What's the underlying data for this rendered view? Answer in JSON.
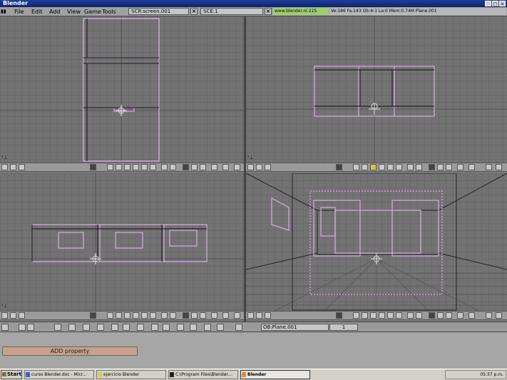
{
  "window": {
    "title": "Blender",
    "min": "_",
    "max": "□",
    "close": "×"
  },
  "menu": [
    "File",
    "Edit",
    "Add",
    "View",
    "Game",
    "Tools"
  ],
  "screen_field": "SCR:screen.001",
  "scene_field": "SCE:1",
  "url": "www.blender.nl 225",
  "stats": "Ve:186 Fa:143  Ob:4-1 La:0  Mem:0.74M  Plane.001",
  "viewport_corner": "⁺ᵧ",
  "buttons_window": {
    "object_field": "OB:Plane.001",
    "object_number": "1",
    "add_property": "ADD property"
  },
  "taskbar": {
    "start": "Start",
    "tasks": [
      {
        "label": "curso Blender.doc - Micr...",
        "icon": "word-icon"
      },
      {
        "label": "ejercicio Blender",
        "icon": "folder-icon"
      },
      {
        "label": "C:\\Program Files\\Blender...",
        "icon": "console-icon"
      },
      {
        "label": "Blender",
        "icon": "blender-icon",
        "active": true
      }
    ],
    "clock": "05:37 p.m."
  },
  "colors": {
    "wire": "#e0a8e8",
    "selected": "#f0c0f8",
    "dark_line": "#222222"
  }
}
